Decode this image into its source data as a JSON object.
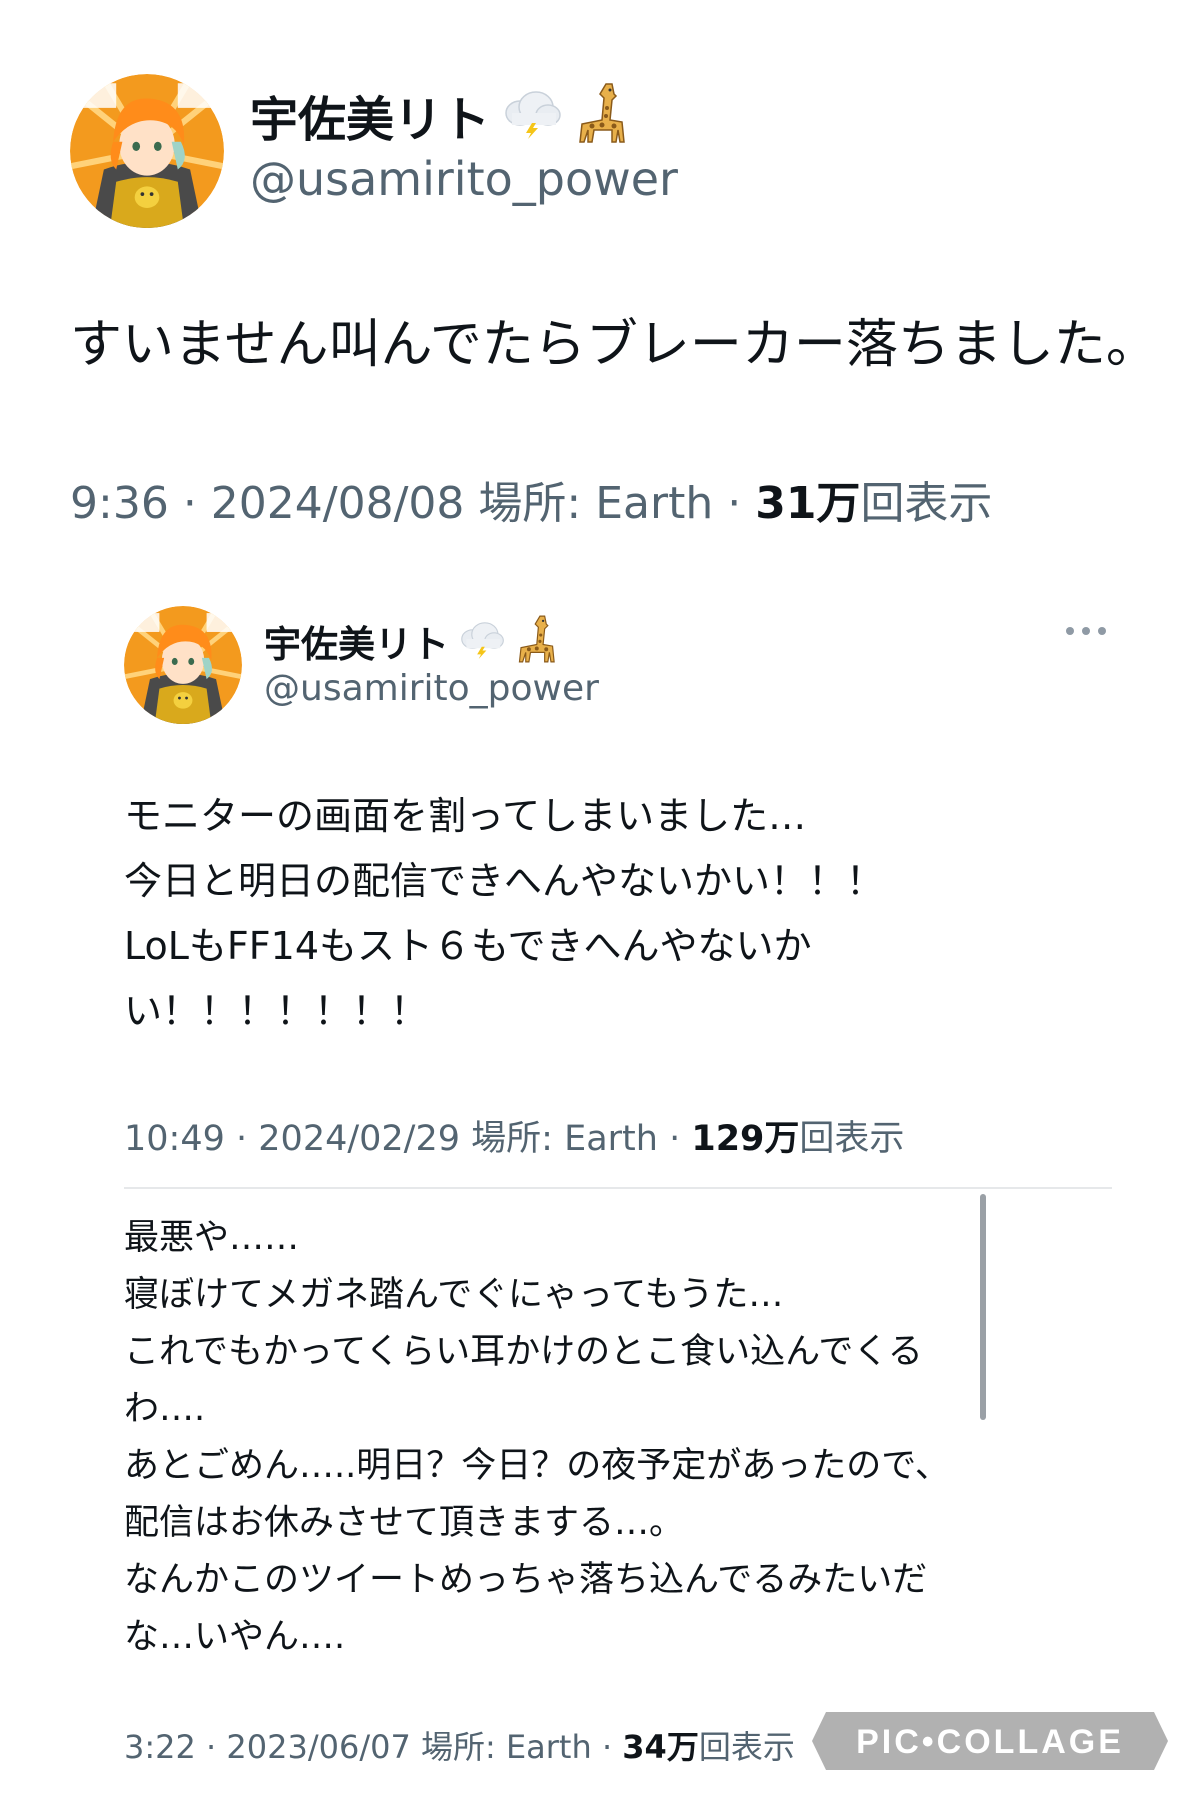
{
  "tweet_main": {
    "display_name": "宇佐美リト",
    "handle": "@usamirito_power",
    "emojis": [
      "cloud-lightning-icon",
      "giraffe-icon"
    ],
    "text": "すいません叫んでたらブレーカー落ちました。",
    "time": "9:36",
    "date": "2024/08/08",
    "location_label": "場所: Earth",
    "views_number": "31万",
    "views_label": "回表示"
  },
  "tweet_quoted": {
    "display_name": "宇佐美リト",
    "handle": "@usamirito_power",
    "emojis": [
      "cloud-lightning-icon",
      "giraffe-icon"
    ],
    "text_lines": [
      "モニターの画面を割ってしまいました…",
      "今日と明日の配信できへんやないかい！！！",
      "LoLもFF14もスト６もできへんやないか",
      "い！！！！！！！"
    ],
    "time": "10:49",
    "date": "2024/02/29",
    "location_label": "場所: Earth",
    "views_number": "129万",
    "views_label": "回表示"
  },
  "tweet_third": {
    "text_lines": [
      "最悪や……",
      "寝ぼけてメガネ踏んでぐにゃってもうた…",
      "これでもかってくらい耳かけのとこ食い込んでくる",
      "わ….",
      "あとごめん…..明日？今日？の夜予定があったので、",
      "配信はお休みさせて頂きまする…。",
      "なんかこのツイートめっちゃ落ち込んでるみたいだ",
      "な…いやん…."
    ],
    "time": "3:22",
    "date": "2023/06/07",
    "location_label": "場所: Earth",
    "views_number": "34万",
    "views_label": "回表示"
  },
  "watermark": {
    "text": "PIC•COLLAGE"
  },
  "colors": {
    "text_primary": "#0f1419",
    "text_secondary": "#536471",
    "divider": "#e6e8ea",
    "avatar_orange": "#f39a1e",
    "avatar_hair": "#ff8c1a"
  }
}
